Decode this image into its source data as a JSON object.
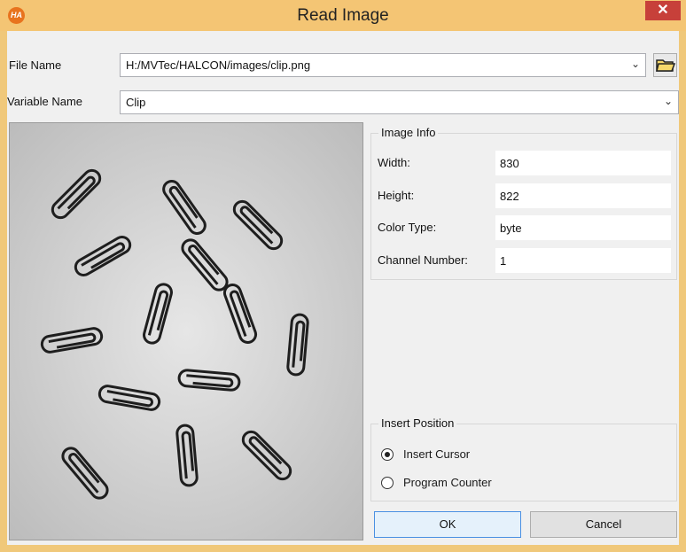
{
  "window": {
    "title": "Read Image",
    "app_icon_text": "HA",
    "close_glyph": "✕"
  },
  "file": {
    "label": "File Name",
    "value": "H:/MVTec/HALCON/images/clip.png"
  },
  "variable": {
    "label": "Variable Name",
    "value": "Clip"
  },
  "image_info": {
    "title": "Image Info",
    "rows": [
      {
        "label": "Width:",
        "value": "830"
      },
      {
        "label": "Height:",
        "value": "822"
      },
      {
        "label": "Color Type:",
        "value": "byte"
      },
      {
        "label": "Channel Number:",
        "value": "1"
      }
    ]
  },
  "insert_position": {
    "title": "Insert Position",
    "options": [
      {
        "label": "Insert Cursor",
        "selected": true
      },
      {
        "label": "Program Counter",
        "selected": false
      }
    ]
  },
  "buttons": {
    "ok": "OK",
    "cancel": "Cancel"
  },
  "icons": {
    "app": "halcon-logo-icon",
    "close": "close-icon",
    "dropdown": "chevron-down-icon",
    "folder": "folder-open-icon",
    "radio_checked": "radio-checked-icon",
    "radio_unchecked": "radio-unchecked-icon"
  },
  "colors": {
    "titlebar": "#f4c574",
    "close": "#c7403a",
    "app_icon": "#e8731e",
    "default_button_border": "#4a90e2"
  }
}
